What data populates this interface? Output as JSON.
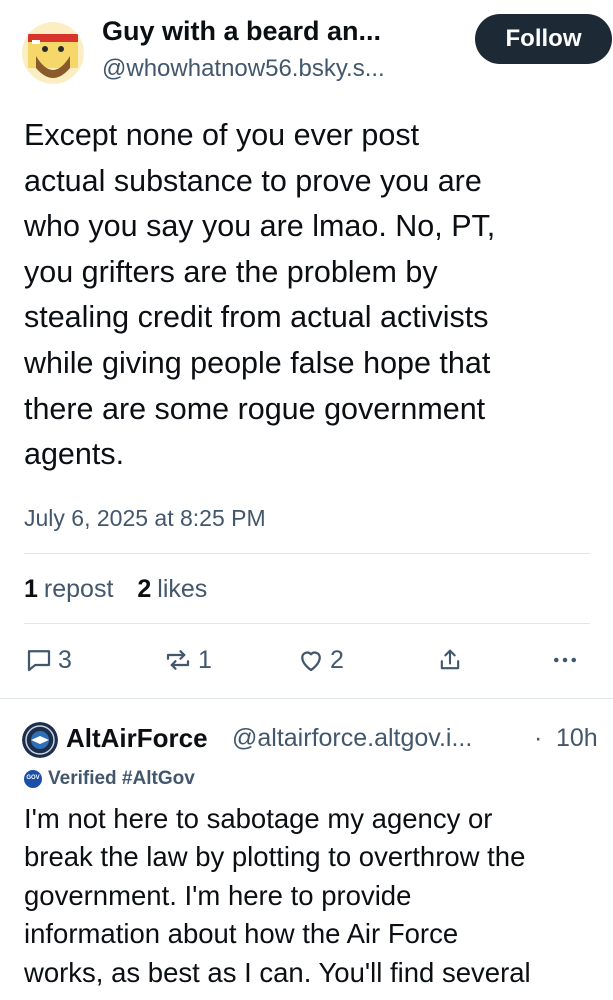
{
  "post": {
    "author_name": "Guy with a beard an...",
    "author_handle": "@whowhatnow56.bsky.s...",
    "follow_label": "Follow",
    "text": "Except none of you ever post\nactual substance to prove you are\nwho you say you are lmao. No, PT,\nyou grifters are the problem by\nstealing credit from actual activists\nwhile giving people false hope that\nthere are some rogue government\nagents.",
    "timestamp": "July 6, 2025 at 8:25 PM",
    "stats": {
      "reposts_count": "1",
      "reposts_label": "repost",
      "likes_count": "2",
      "likes_label": "likes"
    },
    "actions": {
      "reply_count": "3",
      "repost_count": "1",
      "like_count": "2",
      "share_icon": "share-icon",
      "more_icon": "more-icon"
    }
  },
  "reply": {
    "author_name": "AltAirForce",
    "author_handle": "@altairforce.altgov.i...",
    "separator": "·",
    "time": "10h",
    "verified_label": "Verified #AltGov",
    "badge_text": "GOV",
    "text": "I'm not here to sabotage my agency or\nbreak the law by plotting to overthrow the\ngovernment. I'm here to provide\ninformation about how the Air Force\nworks, as best as I can. You'll find several"
  },
  "colors": {
    "text": "#0b0f14",
    "muted": "#42576c",
    "follow_bg": "#1e2936",
    "divider": "#e1e6eb",
    "badge": "#1d4fa8"
  }
}
